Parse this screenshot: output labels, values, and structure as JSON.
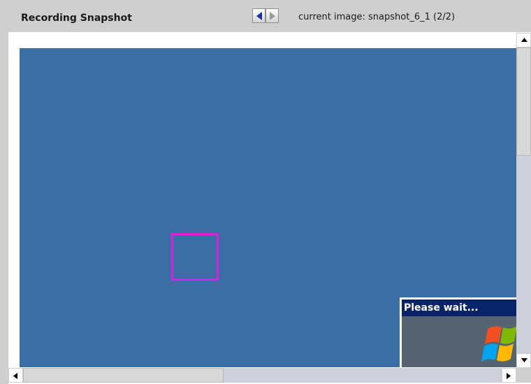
{
  "header": {
    "title": "Recording Snapshot",
    "current_image": "current image: snapshot_6_1 (2/2)"
  },
  "nav": {
    "prev_icon": "triangle-left-icon",
    "next_icon": "triangle-right-icon",
    "prev_color": "#1a2fb0",
    "next_color": "#9a9a9a"
  },
  "snapshot": {
    "desktop_color": "#3a6ea5",
    "highlight_color": "#e01ee0",
    "dialog": {
      "title": "Please wait...",
      "icon": "windows-logo-icon"
    }
  },
  "scrollbars": {
    "vertical_icons": [
      "arrow-up-icon",
      "arrow-down-icon"
    ],
    "horizontal_icons": [
      "arrow-left-icon",
      "arrow-right-icon"
    ]
  }
}
